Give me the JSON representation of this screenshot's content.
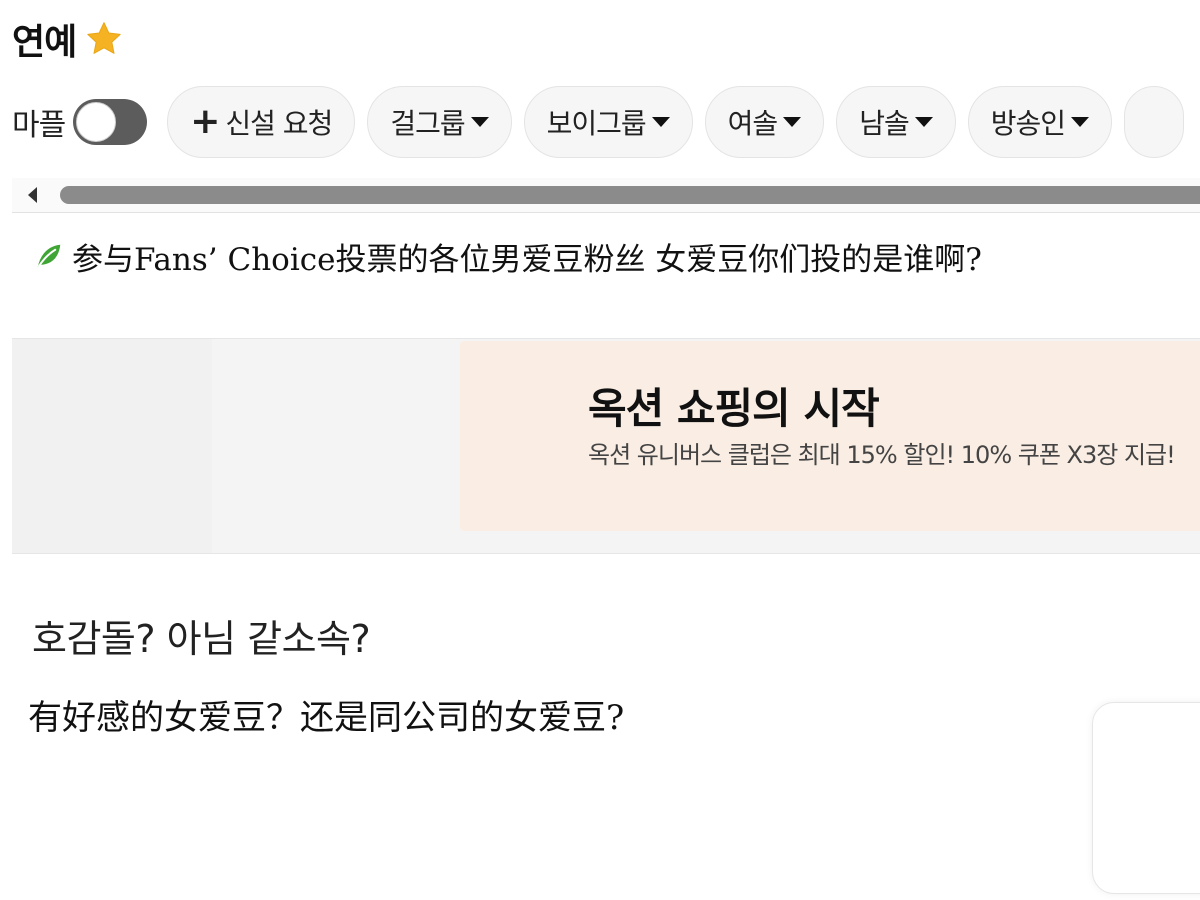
{
  "header": {
    "title": "연예",
    "star_color": "#F5B323"
  },
  "filters": {
    "toggle_label": "마플",
    "toggle_on": false,
    "request_label": "신설 요청",
    "chips": [
      {
        "label": "걸그룹"
      },
      {
        "label": "보이그룹"
      },
      {
        "label": "여솔"
      },
      {
        "label": "남솔"
      },
      {
        "label": "방송인"
      }
    ]
  },
  "post": {
    "title": "参与Fans’ Choice投票的各位男爱豆粉丝 女爱豆你们投的是谁啊?",
    "leaf_color": "#3FA535"
  },
  "ad": {
    "headline": "옥션 쇼핑의 시작",
    "subtext": "옥션 유니버스 클럽은 최대 15% 할인! 10% 쿠폰 X3장 지급!",
    "banner_color": "#FAEEE4"
  },
  "body": {
    "korean_question": "호감돌? 아님 같소속?",
    "chinese_question": "有好感的女爱豆？还是同公司的女爱豆?"
  }
}
